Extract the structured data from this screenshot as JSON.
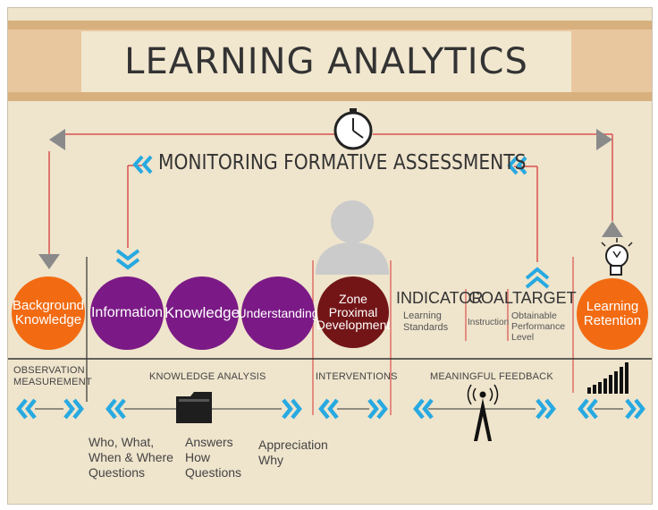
{
  "header": {
    "title": "LEARNING ANALYTICS"
  },
  "monitoring": {
    "title": "MONITORING FORMATIVE ASSESSMENTS"
  },
  "stages": {
    "background": {
      "line1": "Background",
      "line2": "Knowledge"
    },
    "information": {
      "line1": "Information"
    },
    "knowledge": {
      "line1": "Knowledge"
    },
    "understanding": {
      "line1": "Understanding"
    },
    "zpd": {
      "line1": "Zone Proximal",
      "line2": "Development"
    },
    "retention": {
      "line1": "Learning",
      "line2": "Retention"
    }
  },
  "indicators": {
    "indicator": {
      "title": "INDICATOR",
      "sub1": "Learning",
      "sub2": "Standards"
    },
    "goal": {
      "title": "GOAL",
      "sub1": "Instruction"
    },
    "target": {
      "title": "TARGET",
      "sub1": "Obtainable",
      "sub2": "Performance",
      "sub3": "Level"
    }
  },
  "sections": {
    "observation": {
      "line1": "OBSERVATION",
      "line2": "MEASUREMENT"
    },
    "knowledge_analysis": "KNOWLEDGE ANALYSIS",
    "interventions": "INTERVENTIONS",
    "feedback": "MEANINGFUL FEEDBACK"
  },
  "questions": {
    "q1": "Who, What,\nWhen & Where\nQuestions",
    "q2": "Answers\nHow\nQuestions",
    "q3": "Appreciation\nWhy"
  },
  "colors": {
    "orange": "#f26b12",
    "purple": "#7b1a86",
    "maroon": "#731517",
    "cyan": "#27a9e1",
    "red": "#d9534f",
    "gray": "#8a8a8a"
  },
  "icons": [
    "clock-icon",
    "person-icon",
    "lightbulb-icon",
    "folder-icon",
    "antenna-icon",
    "signal-bars-icon",
    "chevron-icon",
    "triangle-arrow-icon"
  ]
}
